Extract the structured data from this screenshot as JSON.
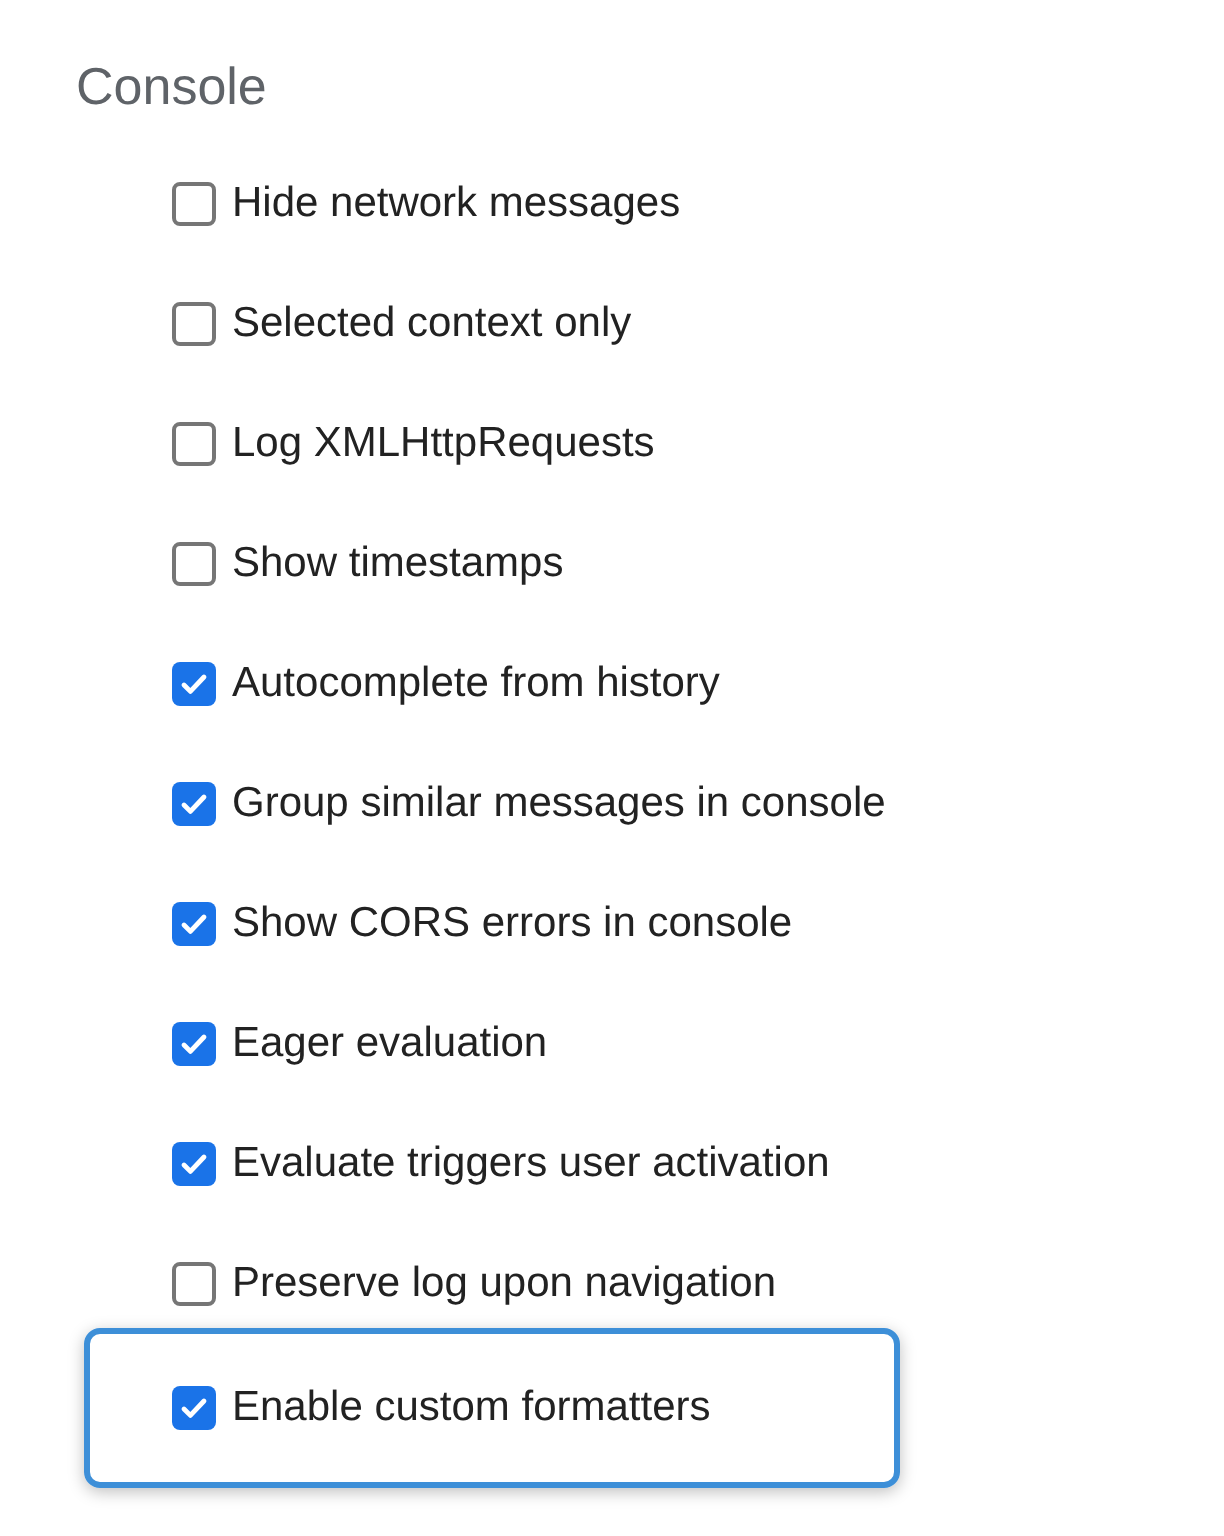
{
  "section": {
    "title": "Console"
  },
  "options": [
    {
      "label": "Hide network messages",
      "checked": false,
      "highlighted": false
    },
    {
      "label": "Selected context only",
      "checked": false,
      "highlighted": false
    },
    {
      "label": "Log XMLHttpRequests",
      "checked": false,
      "highlighted": false
    },
    {
      "label": "Show timestamps",
      "checked": false,
      "highlighted": false
    },
    {
      "label": "Autocomplete from history",
      "checked": true,
      "highlighted": false
    },
    {
      "label": "Group similar messages in console",
      "checked": true,
      "highlighted": false
    },
    {
      "label": "Show CORS errors in console",
      "checked": true,
      "highlighted": false
    },
    {
      "label": "Eager evaluation",
      "checked": true,
      "highlighted": false
    },
    {
      "label": "Evaluate triggers user activation",
      "checked": true,
      "highlighted": false
    },
    {
      "label": "Preserve log upon navigation",
      "checked": false,
      "highlighted": false
    },
    {
      "label": "Enable custom formatters",
      "checked": true,
      "highlighted": true
    }
  ]
}
